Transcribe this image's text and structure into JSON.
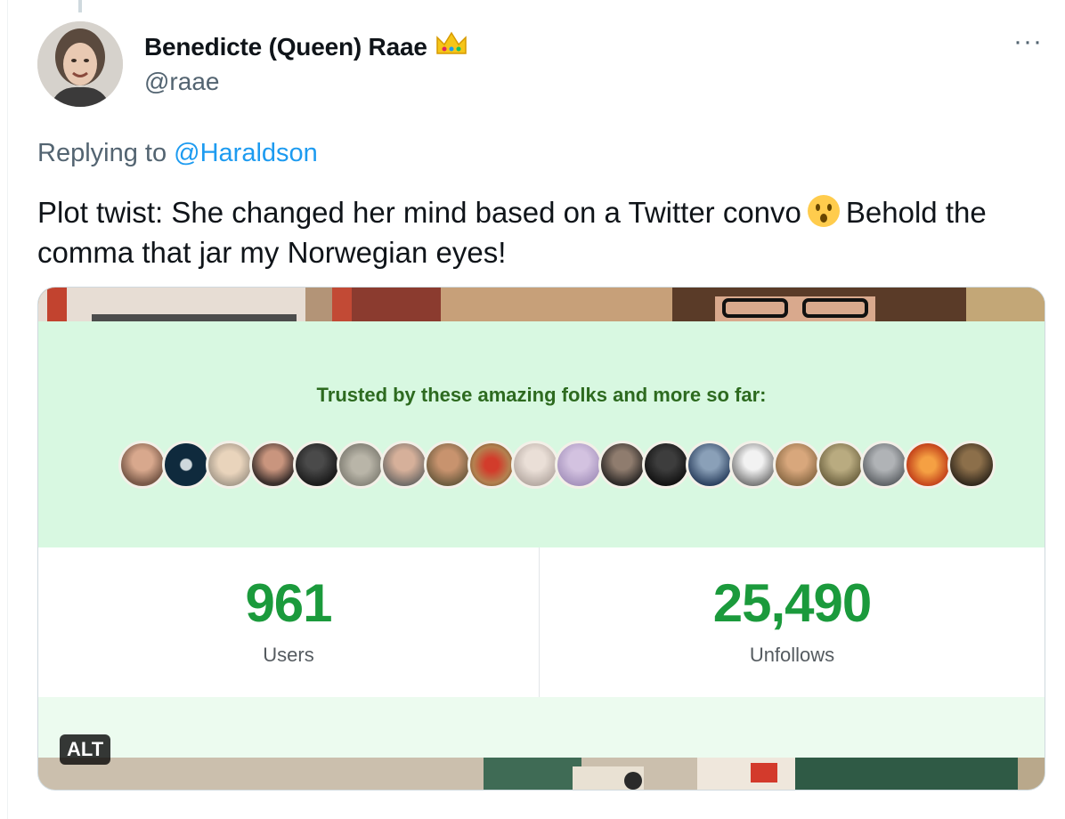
{
  "author": {
    "name": "Benedicte (Queen) Raae",
    "handle": "@raae",
    "name_emoji": "crown-emoji"
  },
  "tweet": {
    "replying_prefix": "Replying to ",
    "replying_to": "@Haraldson",
    "text_part1": "Plot twist: She changed her mind based on a Twitter convo",
    "text_part2": "Behold the comma that jar my Norwegian eyes!",
    "emoji": "astonished-face-emoji"
  },
  "media": {
    "trusted_heading": "Trusted by these amazing folks and more so far:",
    "avatar_count": 20,
    "stats": [
      {
        "value": "961",
        "label": "Users"
      },
      {
        "value": "25,490",
        "label": "Unfollows"
      }
    ],
    "alt_badge": "ALT"
  },
  "menu": {
    "more_label": "···"
  },
  "colors": {
    "accent": "#1d9bf0",
    "stat_green": "#1b9a3c",
    "panel_green": "#d8f8e1",
    "heading_green": "#2d6a1f"
  }
}
